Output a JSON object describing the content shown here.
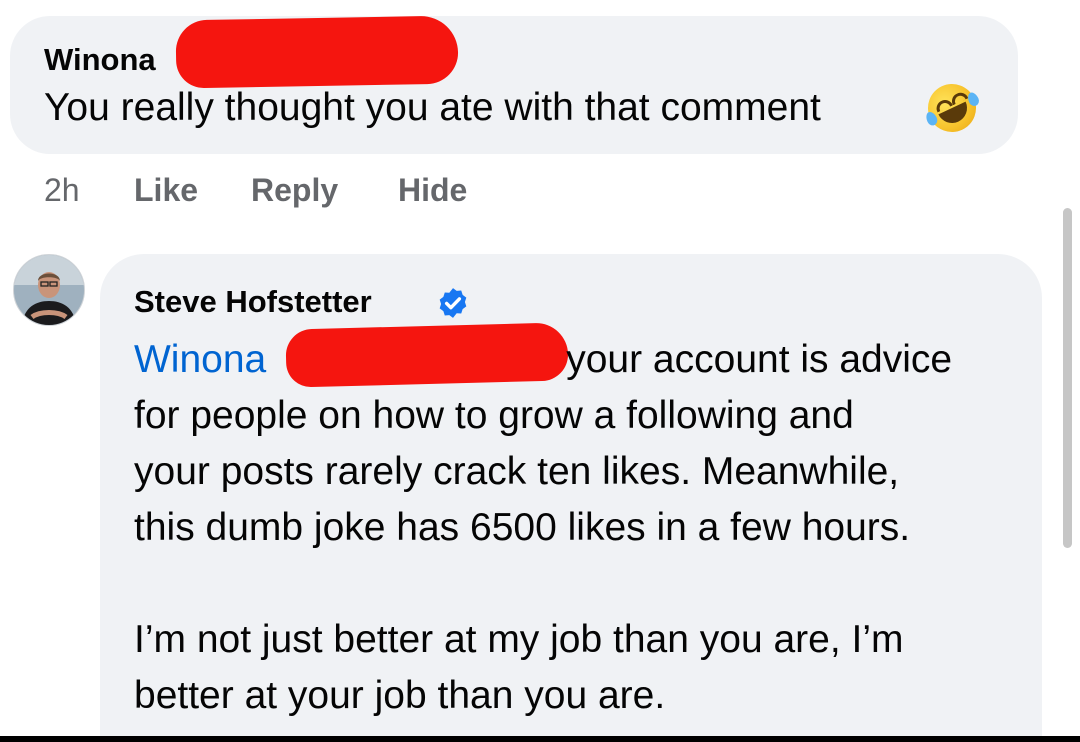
{
  "comment": {
    "author": "Winona",
    "text": "You really thought you ate with that comment",
    "emoji": "rolling-on-floor-laughing",
    "time": "2h",
    "actions": {
      "like": "Like",
      "reply": "Reply",
      "hide": "Hide"
    }
  },
  "reply": {
    "author": "Steve Hofstetter",
    "verified": true,
    "mention": "Winona",
    "line1_rest": "your account is advice",
    "body_lines": [
      "for people on how to grow a following and",
      "your posts rarely crack ten likes. Meanwhile,",
      "this dumb joke has 6500 likes in a few hours."
    ],
    "second_paragraph": [
      "I’m not just better at my job than you are, I’m",
      "better at your job than you are."
    ]
  },
  "colors": {
    "bubble": "#f0f2f5",
    "mention": "#0064d1",
    "muted": "#65676b",
    "verified": "#1877f2",
    "redaction": "#f5150f"
  }
}
